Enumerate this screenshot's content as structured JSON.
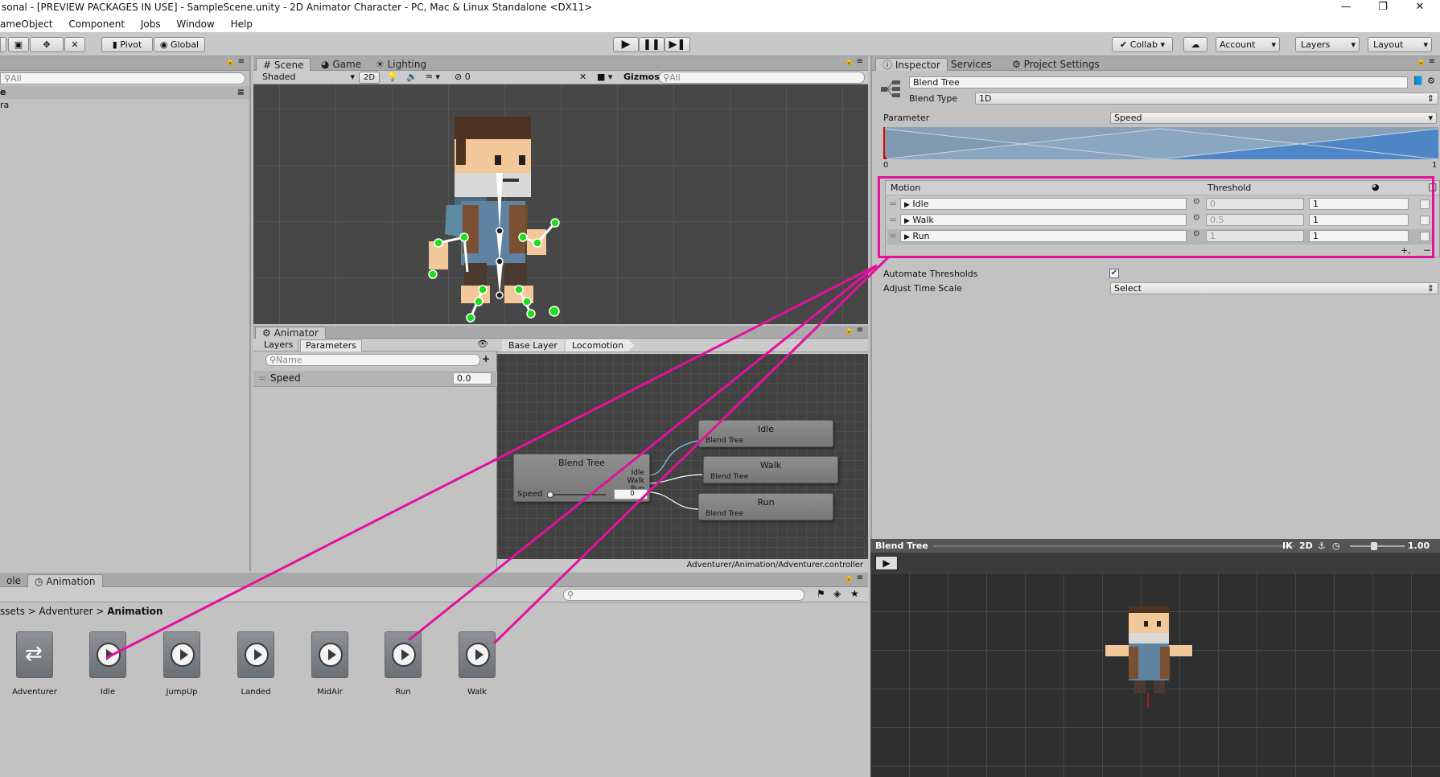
{
  "window": {
    "title": "sonal - [PREVIEW PACKAGES IN USE] - SampleScene.unity - 2D Animator Character - PC, Mac & Linux Standalone <DX11>",
    "minimize": "—",
    "restore": "❐",
    "close": "✕"
  },
  "menu": [
    "ameObject",
    "Component",
    "Jobs",
    "Window",
    "Help"
  ],
  "toolbar": {
    "pivot": "Pivot",
    "global": "Global",
    "collab": "Collab",
    "account": "Account",
    "layers": "Layers",
    "layout": "Layout"
  },
  "hierarchy": {
    "search_placeholder": "All",
    "scene_row": "e",
    "item": "ra"
  },
  "scene": {
    "tabs": [
      "Scene",
      "Game",
      "Lighting"
    ],
    "shading": "Shaded",
    "mode_2d": "2D",
    "effects_count": "0",
    "gizmos": "Gizmos",
    "search_placeholder": "All"
  },
  "animator": {
    "tab": "Animator",
    "subtabs": [
      "Layers",
      "Parameters"
    ],
    "search_placeholder": "Name",
    "parameter": {
      "name": "Speed",
      "value": "0.0"
    },
    "breadcrumb": [
      "Base Layer",
      "Locomotion"
    ],
    "controller_path": "Adventurer/Animation/Adventurer.controller",
    "blend_node": {
      "title": "Blend Tree",
      "ports": [
        "Idle",
        "Walk",
        "Run"
      ],
      "param": "Speed",
      "value": "0"
    },
    "motion_nodes": [
      {
        "title": "Idle",
        "sub": "Blend Tree"
      },
      {
        "title": "Walk",
        "sub": "Blend Tree"
      },
      {
        "title": "Run",
        "sub": "Blend Tree"
      }
    ]
  },
  "project": {
    "tabs": [
      "ole",
      "Animation"
    ],
    "breadcrumb": [
      "ssets",
      "Adventurer",
      "Animation"
    ],
    "assets": [
      "Adventurer",
      "Idle",
      "JumpUp",
      "Landed",
      "MidAir",
      "Run",
      "Walk"
    ]
  },
  "inspector": {
    "tabs": [
      "Inspector",
      "Services",
      "Project Settings"
    ],
    "name": "Blend Tree",
    "blend_type_label": "Blend Type",
    "blend_type": "1D",
    "parameter_label": "Parameter",
    "parameter": "Speed",
    "range_min": "0",
    "range_max": "1",
    "motion_header": "Motion",
    "threshold_header": "Threshold",
    "motions": [
      {
        "name": "Idle",
        "threshold": "0",
        "speed": "1"
      },
      {
        "name": "Walk",
        "threshold": "0.5",
        "speed": "1"
      },
      {
        "name": "Run",
        "threshold": "1",
        "speed": "1"
      }
    ],
    "add": "+,",
    "remove": "−",
    "automate_label": "Automate Thresholds",
    "automate": true,
    "adjust_label": "Adjust Time Scale",
    "adjust_value": "Select"
  },
  "preview": {
    "title": "Blend Tree",
    "ik": "IK",
    "mode_2d": "2D",
    "speed": "1.00"
  },
  "colors": {
    "highlight": "#e4109e",
    "accent": "#3b7bd4"
  }
}
